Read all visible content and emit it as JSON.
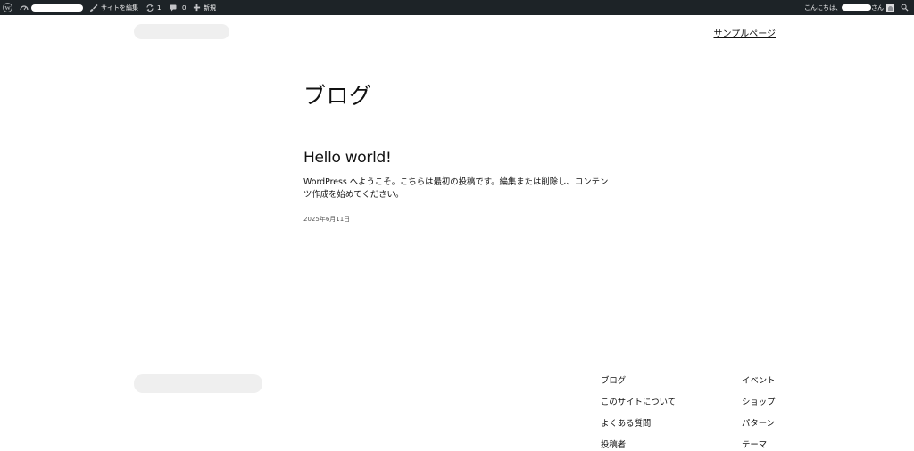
{
  "admin_bar": {
    "edit_site_label": "サイトを編集",
    "updates_count": "1",
    "comments_count": "0",
    "new_label": "新規",
    "greeting_prefix": "こんにちは、",
    "greeting_suffix": "さん"
  },
  "header": {
    "nav": {
      "sample_page": "サンプルページ"
    }
  },
  "main": {
    "page_title": "ブログ",
    "post": {
      "title": "Hello world!",
      "excerpt": "WordPress へようこそ。こちらは最初の投稿です。編集または削除し、コンテンツ作成を始めてください。",
      "date": "2025年6月11日"
    }
  },
  "footer": {
    "col1": [
      "ブログ",
      "このサイトについて",
      "よくある質問",
      "投稿者"
    ],
    "col2": [
      "イベント",
      "ショップ",
      "パターン",
      "テーマ"
    ]
  },
  "colors": {
    "admin_bar_bg": "#1d2327",
    "page_bg": "#ffffff",
    "text": "#111111"
  }
}
